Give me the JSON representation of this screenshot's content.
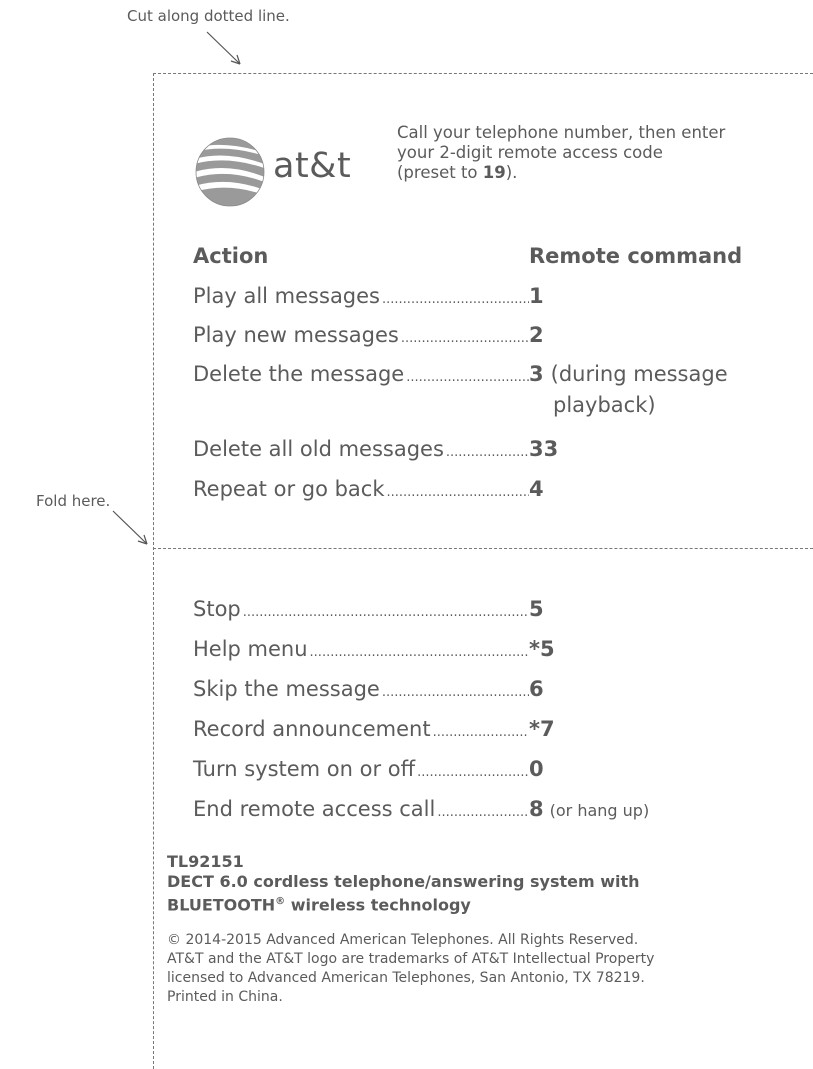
{
  "guides": {
    "cut_text": "Cut along dotted line.",
    "fold_text": "Fold here."
  },
  "brand": {
    "logo_text": "at&t",
    "logo_icon": "globe-icon"
  },
  "intro": {
    "line1": "Call your telephone number, then enter",
    "line2": "your 2-digit remote access code",
    "line3_pre": "(preset to ",
    "line3_code": "19",
    "line3_post": ")."
  },
  "table": {
    "header_action": "Action",
    "header_command": "Remote command",
    "rows_top": [
      {
        "action": "Play all messages",
        "command": "1"
      },
      {
        "action": "Play new messages",
        "command": "2"
      },
      {
        "action": "Delete the message",
        "command": "3",
        "extra1": "(during message",
        "extra2": "playback)"
      },
      {
        "action": "Delete all old messages",
        "command": "33"
      },
      {
        "action": "Repeat or go back",
        "command": "4"
      }
    ],
    "rows_bottom": [
      {
        "action": "Stop",
        "command": "5"
      },
      {
        "action": "Help menu",
        "command": "*5"
      },
      {
        "action": "Skip the message",
        "command": "6"
      },
      {
        "action": "Record announcement",
        "command": "*7"
      },
      {
        "action": "Turn system on or off",
        "command": "0"
      },
      {
        "action": "End remote access call",
        "command": "8",
        "extra_small": "(or hang up)"
      }
    ]
  },
  "footer": {
    "model": "TL92151",
    "desc1": "DECT 6.0 cordless telephone/answering system with",
    "desc2_pre": "BLUETOOTH",
    "desc2_reg": "®",
    "desc2_post": " wireless technology",
    "legal1": "© 2014-2015 Advanced American Telephones. All Rights Reserved.",
    "legal2": "AT&T and the AT&T logo are trademarks of AT&T Intellectual Property",
    "legal3": "licensed to Advanced American Telephones, San Antonio, TX 78219.",
    "legal4": "Printed in China."
  }
}
